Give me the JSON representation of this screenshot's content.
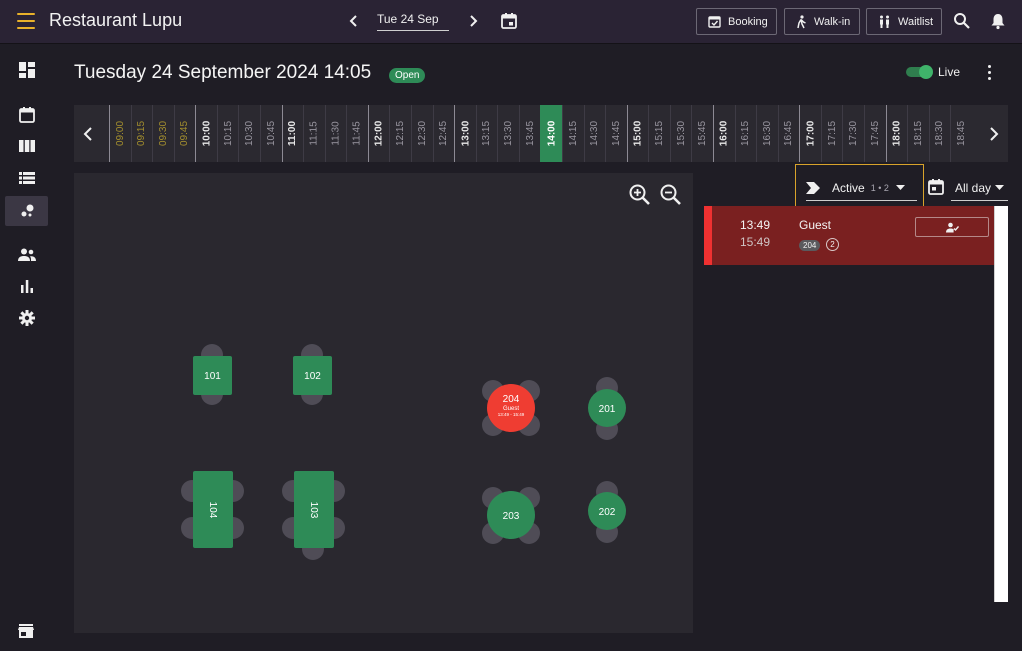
{
  "header": {
    "app_title": "Restaurant Lupu",
    "current_date": "Tue 24 Sep",
    "buttons": {
      "booking": "Booking",
      "walkin": "Walk-in",
      "waitlist": "Waitlist"
    }
  },
  "page": {
    "heading": "Tuesday 24 September 2024 14:05",
    "status": "Open",
    "live_label": "Live"
  },
  "timeline": {
    "slots": [
      "09:00",
      "09:15",
      "09:30",
      "09:45",
      "10:00",
      "10:15",
      "10:30",
      "10:45",
      "11:00",
      "11:15",
      "11:30",
      "11:45",
      "12:00",
      "12:15",
      "12:30",
      "12:45",
      "13:00",
      "13:15",
      "13:30",
      "13:45",
      "14:00",
      "14:15",
      "14:30",
      "14:45",
      "15:00",
      "15:15",
      "15:30",
      "15:45",
      "16:00",
      "16:15",
      "16:30",
      "16:45",
      "17:00",
      "17:15",
      "17:30",
      "17:45",
      "18:00",
      "18:15",
      "18:30",
      "18:45"
    ],
    "current": "14:00",
    "past_until": "09:45"
  },
  "floor": {
    "tables": {
      "t101": "101",
      "t102": "102",
      "t103": "103",
      "t104": "104",
      "t201": "201",
      "t202": "202",
      "t203": "203",
      "t204": "204"
    },
    "t204_guest": "Guest",
    "t204_time": "13:49 - 15:49"
  },
  "filters": {
    "status_label": "Active",
    "status_count": "1 • 2",
    "day_label": "All day"
  },
  "reservations": [
    {
      "start": "13:49",
      "end": "15:49",
      "name": "Guest",
      "table": "204",
      "pax": "2"
    }
  ],
  "colors": {
    "accent": "#e8b12a",
    "open_green": "#2e8b57",
    "table_free": "#2e8b57",
    "table_occupied": "#ef3d32",
    "reservation_bg": "#7a2020"
  }
}
